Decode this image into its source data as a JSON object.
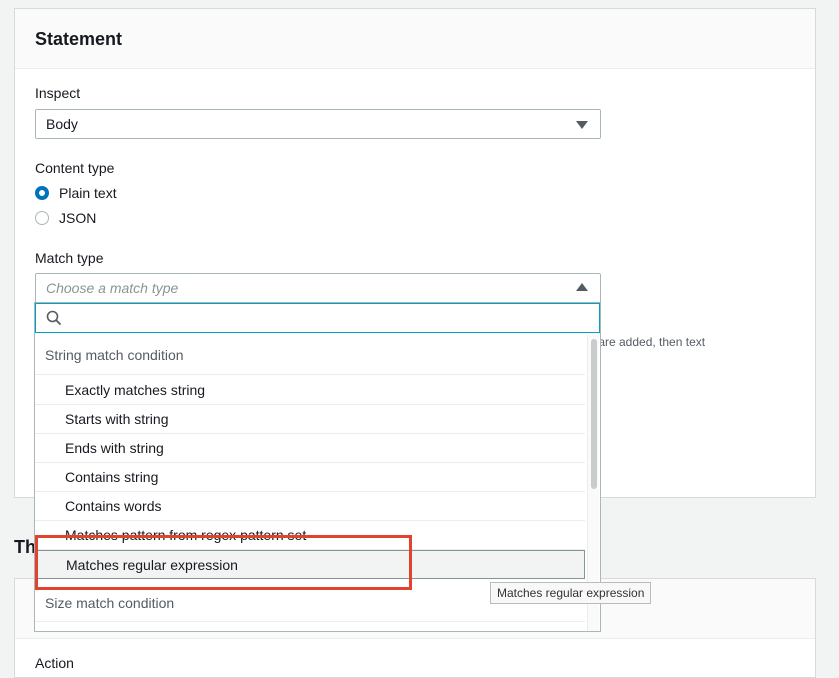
{
  "statement": {
    "title": "Statement",
    "inspect": {
      "label": "Inspect",
      "value": "Body"
    },
    "content_type": {
      "label": "Content type",
      "options": [
        {
          "label": "Plain text",
          "checked": true
        },
        {
          "label": "JSON",
          "checked": false
        }
      ]
    },
    "match_type": {
      "label": "Match type",
      "placeholder": "Choose a match type"
    },
    "partial_description": "s are added, then text"
  },
  "dropdown": {
    "search_placeholder": "",
    "group_string": "String match condition",
    "options": [
      "Exactly matches string",
      "Starts with string",
      "Ends with string",
      "Contains string",
      "Contains words",
      "Matches pattern from regex pattern set",
      "Matches regular expression"
    ],
    "highlighted_index": 6,
    "group_size": "Size match condition"
  },
  "section2": {
    "title_partial": "Th"
  },
  "action": {
    "label": "Action"
  },
  "tooltip": {
    "text": "Matches regular expression"
  },
  "colors": {
    "accent": "#0073bb",
    "focus": "#00a1c9",
    "annotation": "#e0442c"
  }
}
